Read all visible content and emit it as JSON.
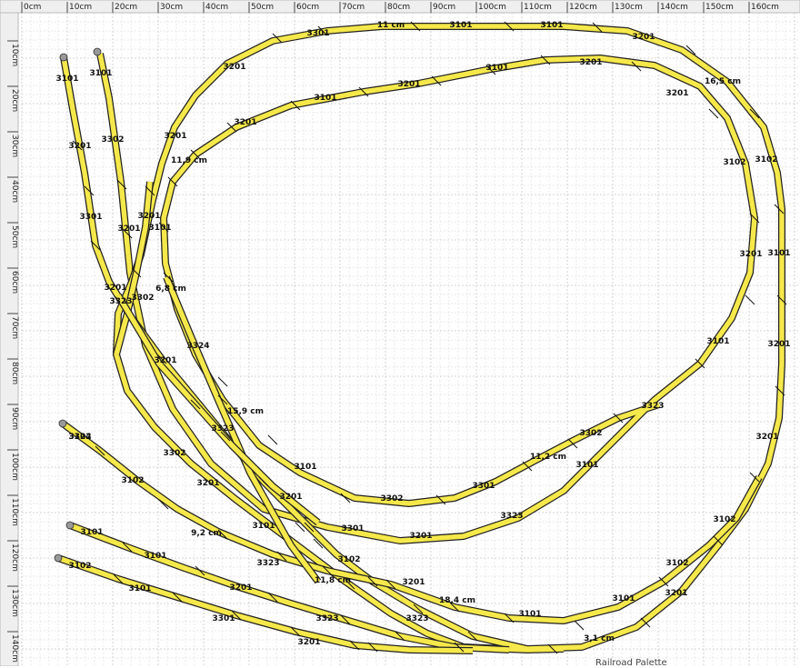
{
  "ruler": {
    "x_ticks": [
      "0cm",
      "10cm",
      "20cm",
      "30cm",
      "40cm",
      "50cm",
      "60cm",
      "70cm",
      "80cm",
      "90cm",
      "100cm",
      "110cm",
      "120cm",
      "130cm",
      "140cm",
      "150cm",
      "160cm"
    ],
    "y_ticks": [
      "10cm",
      "20cm",
      "30cm",
      "40cm",
      "50cm",
      "60cm",
      "70cm",
      "80cm",
      "90cm",
      "100cm",
      "110cm",
      "120cm",
      "130cm",
      "140cm"
    ]
  },
  "track_labels": [
    "3301",
    "11 cm",
    "3101",
    "3101",
    "3201",
    "3201",
    "3101",
    "3201",
    "3201",
    "16,5 cm",
    "3101",
    "3201",
    "3201",
    "3102",
    "3102",
    "3101",
    "3101",
    "3201",
    "3302",
    "3201",
    "11,9 cm",
    "3301",
    "3201",
    "3101",
    "3201",
    "3201",
    "3101",
    "3201",
    "3302",
    "6,8 cm",
    "3324",
    "3323",
    "3201",
    "3101",
    "3201",
    "3323",
    "15,9 cm",
    "3323",
    "3302",
    "3102",
    "3302",
    "11,2 cm",
    "3101",
    "3201",
    "3101",
    "3102",
    "3201",
    "3201",
    "3302",
    "3301",
    "3301",
    "3201",
    "3323",
    "3102",
    "3324",
    "3101",
    "9,2 cm",
    "3101",
    "3102",
    "3101",
    "3102",
    "3323",
    "3102",
    "11,8 cm",
    "3201",
    "18,4 cm",
    "3101",
    "3101",
    "3101",
    "3201",
    "3201",
    "3301",
    "3323",
    "3323",
    "3,1 cm",
    "3201"
  ],
  "footer": {
    "text": "Railroad Palette"
  },
  "colors": {
    "rail_fill": "#f5e84a",
    "rail_stroke": "#222222",
    "grid": "#c8c8c8",
    "end_marker": "#999999"
  }
}
